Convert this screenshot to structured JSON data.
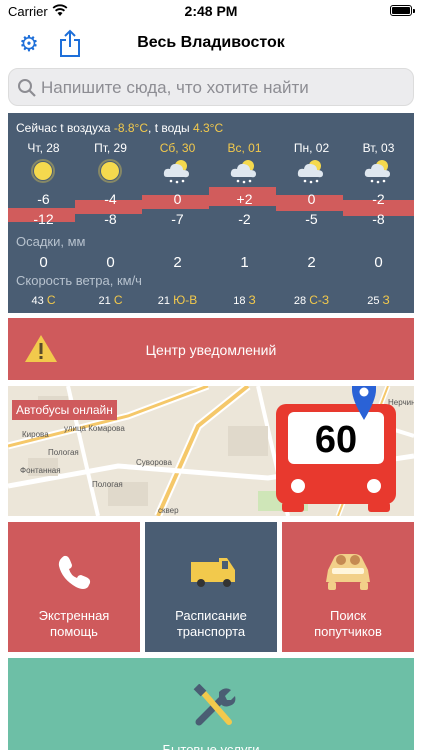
{
  "status": {
    "carrier": "Carrier",
    "time": "2:48 PM"
  },
  "nav": {
    "title": "Весь Владивосток"
  },
  "search": {
    "placeholder": "Напишите сюда, что хотите найти"
  },
  "weather": {
    "now_prefix": "Сейчас t воздуха ",
    "air": "-8.8°C",
    "water_prefix": ", t воды ",
    "water": "4.3°C",
    "days": [
      {
        "label": "Чт, 28",
        "weekend": false,
        "icon": "sun-icon",
        "high": "-6",
        "low": "-12",
        "precip": "0",
        "wind_speed": "43",
        "wind_dir": "С"
      },
      {
        "label": "Пт, 29",
        "weekend": false,
        "icon": "sun-icon",
        "high": "-4",
        "low": "-8",
        "precip": "0",
        "wind_speed": "21",
        "wind_dir": "С"
      },
      {
        "label": "Сб, 30",
        "weekend": true,
        "icon": "cloud-snow-icon",
        "high": "0",
        "low": "-7",
        "precip": "2",
        "wind_speed": "21",
        "wind_dir": "Ю-В"
      },
      {
        "label": "Вс, 01",
        "weekend": true,
        "icon": "cloud-snow-icon",
        "high": "+2",
        "low": "-2",
        "precip": "1",
        "wind_speed": "18",
        "wind_dir": "З"
      },
      {
        "label": "Пн, 02",
        "weekend": false,
        "icon": "cloud-snow-icon",
        "high": "0",
        "low": "-5",
        "precip": "2",
        "wind_speed": "28",
        "wind_dir": "С-З"
      },
      {
        "label": "Вт, 03",
        "weekend": false,
        "icon": "cloud-snow-icon",
        "high": "-2",
        "low": "-8",
        "precip": "0",
        "wind_speed": "25",
        "wind_dir": "З"
      }
    ],
    "precip_label": "Осадки, мм",
    "wind_label": "Скорость ветра, км/ч"
  },
  "notifications": {
    "label": "Центр уведомлений"
  },
  "map": {
    "tag": "Автобусы онлайн",
    "bus_number": "60",
    "streets": [
      "Кирова",
      "Фонтанная",
      "Пологая",
      "Пологая",
      "улица Комарова",
      "Суворова",
      "сквер",
      "Нерчинская"
    ]
  },
  "tiles": [
    {
      "line1": "Экстренная",
      "line2": "помощь"
    },
    {
      "line1": "Расписание",
      "line2": "транспорта"
    },
    {
      "line1": "Поиск",
      "line2": "попутчиков"
    }
  ],
  "bottom": {
    "label": "Бытовые услуги"
  },
  "colors": {
    "accent": "#1e6fd9",
    "red": "#cf5a5c",
    "slate": "#4a5d73",
    "mint": "#6dbfa6",
    "yellow": "#f2c94c"
  }
}
